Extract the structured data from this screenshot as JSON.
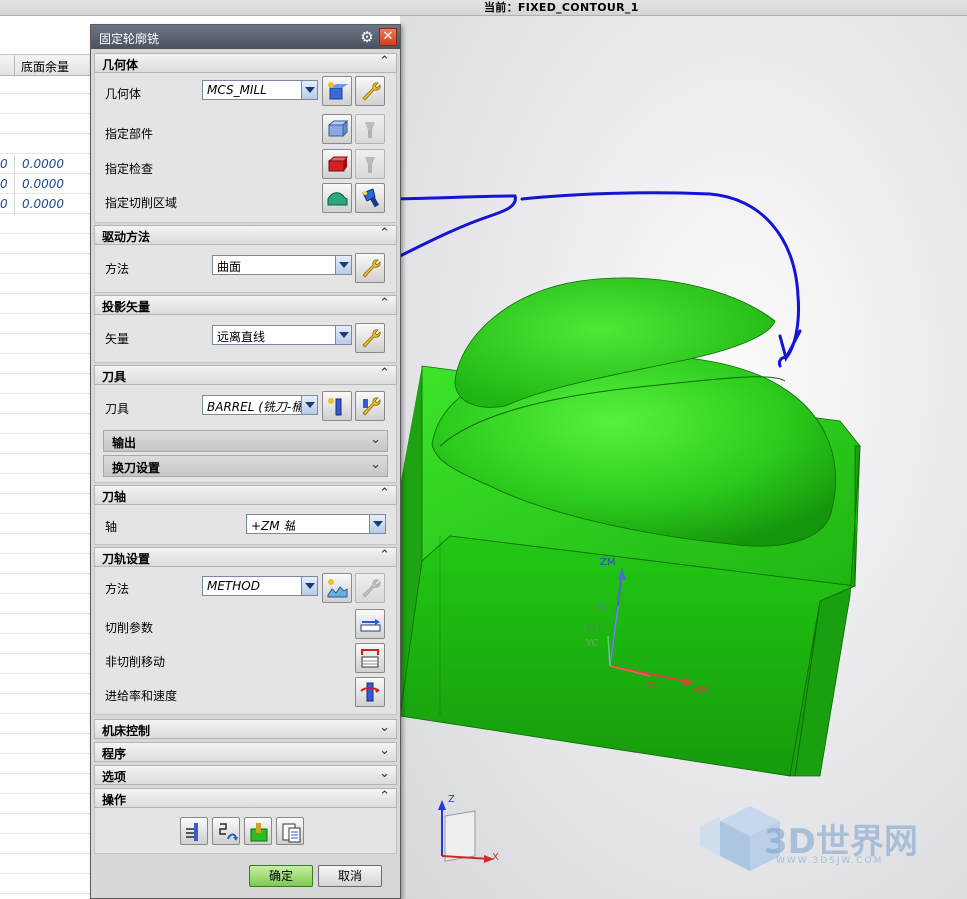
{
  "status": {
    "current": "当前：FIXED_CONTOUR_1"
  },
  "table": {
    "header": "底面余量",
    "rows": [
      {
        "c0": "0",
        "c1": "0.0000"
      },
      {
        "c0": "0",
        "c1": "0.0000"
      },
      {
        "c0": "0",
        "c1": "0.0000"
      }
    ]
  },
  "dialog": {
    "title": "固定轮廓铣",
    "geometry": {
      "title": "几何体",
      "geometry_label": "几何体",
      "geometry_value": "MCS_MILL",
      "part_label": "指定部件",
      "check_label": "指定检查",
      "cut_area_label": "指定切削区域"
    },
    "drive": {
      "title": "驱动方法",
      "method_label": "方法",
      "method_value": "曲面"
    },
    "projection": {
      "title": "投影矢量",
      "vector_label": "矢量",
      "vector_value": "远离直线"
    },
    "tool": {
      "title": "刀具",
      "tool_label": "刀具",
      "tool_value": "BARREL (铣刀-桶",
      "output_label": "输出",
      "toolchange_label": "换刀设置"
    },
    "axis": {
      "title": "刀轴",
      "axis_label": "轴",
      "axis_value": "+ZM 轴"
    },
    "path": {
      "title": "刀轨设置",
      "method_label": "方法",
      "method_value": "METHOD",
      "cut_params_label": "切削参数",
      "noncut_label": "非切削移动",
      "feeds_label": "进给率和速度"
    },
    "machine_control": {
      "title": "机床控制"
    },
    "program": {
      "title": "程序"
    },
    "options": {
      "title": "选项"
    },
    "operation": {
      "title": "操作"
    },
    "ok_label": "确定",
    "cancel_label": "取消"
  },
  "viewport": {
    "axis_labels": {
      "zm": "ZM",
      "zc": "ZC",
      "ym": "YM",
      "yc": "YC",
      "xc": "XC",
      "xm": "XM"
    },
    "triad_labels": {
      "z": "Z",
      "x": "X"
    },
    "watermark": "3D世界网",
    "watermark_url": "WWW.3DSJW.COM",
    "model_color": "#22c814",
    "annotation_color": "#1414d2"
  },
  "icons": {
    "gear": "gear-icon",
    "close": "close-icon",
    "collapse": "chevron-up-icon",
    "expand": "chevron-down-icon"
  }
}
